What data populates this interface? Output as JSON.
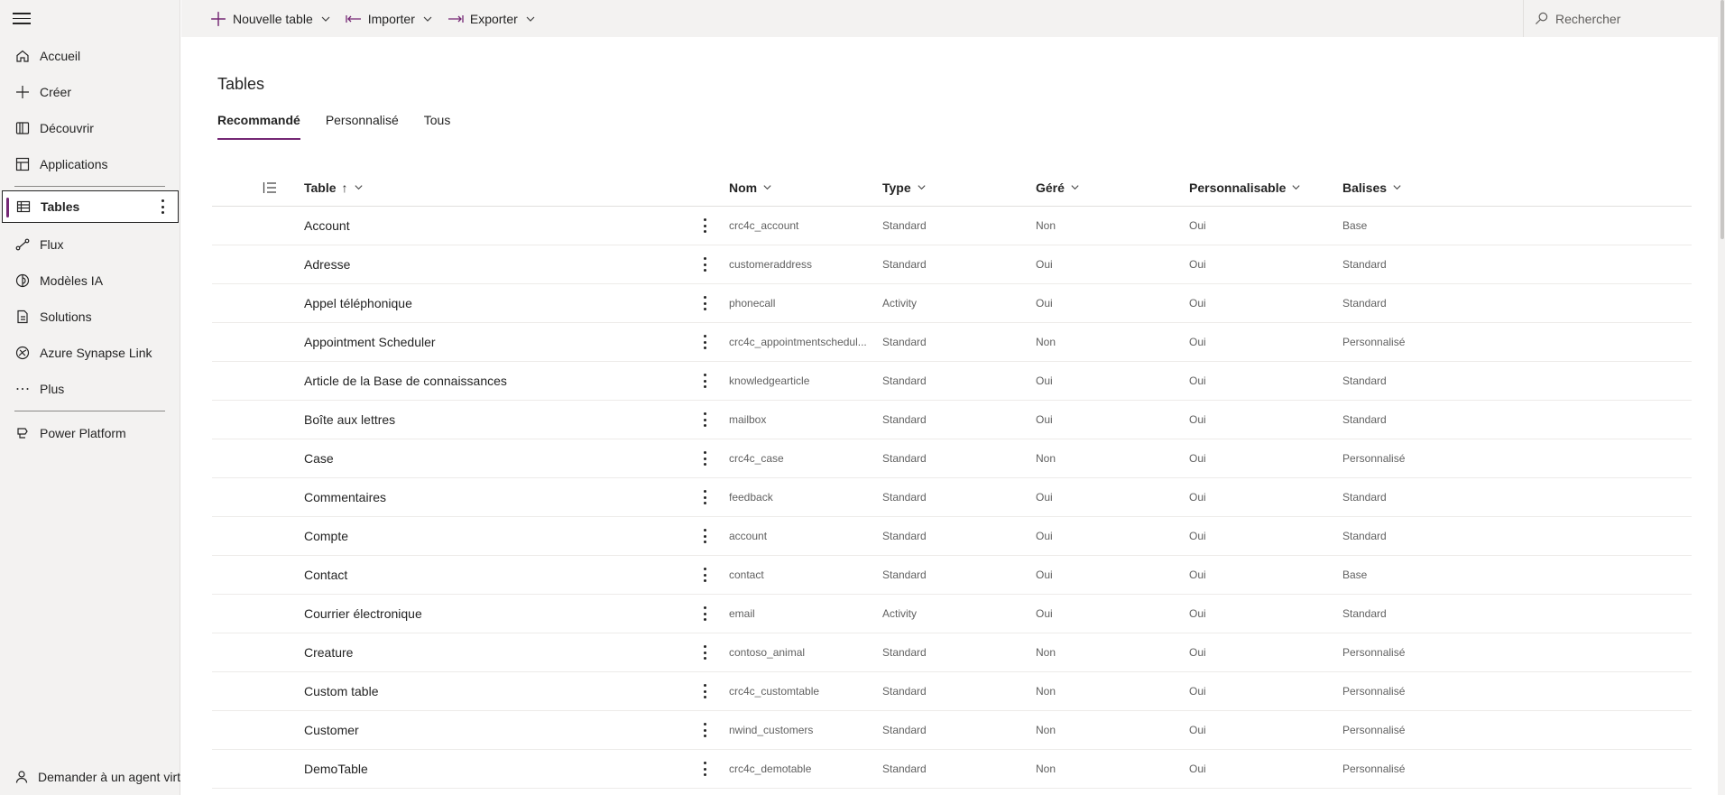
{
  "sidebar": {
    "items": [
      {
        "label": "Accueil",
        "icon": "home-icon"
      },
      {
        "label": "Créer",
        "icon": "plus-icon"
      },
      {
        "label": "Découvrir",
        "icon": "book-icon"
      },
      {
        "label": "Applications",
        "icon": "apps-icon"
      },
      {
        "label": "Tables",
        "icon": "table-icon"
      },
      {
        "label": "Flux",
        "icon": "flow-icon"
      },
      {
        "label": "Modèles IA",
        "icon": "ai-model-icon"
      },
      {
        "label": "Solutions",
        "icon": "solutions-icon"
      },
      {
        "label": "Azure Synapse Link",
        "icon": "synapse-icon"
      },
      {
        "label": "Plus",
        "icon": "ellipsis-icon"
      },
      {
        "label": "Power Platform",
        "icon": "power-platform-icon"
      }
    ],
    "bottom_label": "Demander à un agent virt"
  },
  "toolbar": {
    "new_table": "Nouvelle table",
    "import": "Importer",
    "export": "Exporter",
    "search_placeholder": "Rechercher"
  },
  "page": {
    "title": "Tables",
    "tabs": [
      "Recommandé",
      "Personnalisé",
      "Tous"
    ],
    "active_tab": "Recommandé"
  },
  "grid": {
    "columns": {
      "table": "Table",
      "sort_indicator": "↑",
      "name": "Nom",
      "type": "Type",
      "managed": "Géré",
      "customizable": "Personnalisable",
      "tags": "Balises"
    },
    "rows": [
      {
        "table": "Account",
        "name": "crc4c_account",
        "type": "Standard",
        "managed": "Non",
        "customizable": "Oui",
        "tags": "Base"
      },
      {
        "table": "Adresse",
        "name": "customeraddress",
        "type": "Standard",
        "managed": "Oui",
        "customizable": "Oui",
        "tags": "Standard"
      },
      {
        "table": "Appel téléphonique",
        "name": "phonecall",
        "type": "Activity",
        "managed": "Oui",
        "customizable": "Oui",
        "tags": "Standard"
      },
      {
        "table": "Appointment Scheduler",
        "name": "crc4c_appointmentschedul...",
        "type": "Standard",
        "managed": "Non",
        "customizable": "Oui",
        "tags": "Personnalisé"
      },
      {
        "table": "Article de la Base de connaissances",
        "name": "knowledgearticle",
        "type": "Standard",
        "managed": "Oui",
        "customizable": "Oui",
        "tags": "Standard"
      },
      {
        "table": "Boîte aux lettres",
        "name": "mailbox",
        "type": "Standard",
        "managed": "Oui",
        "customizable": "Oui",
        "tags": "Standard"
      },
      {
        "table": "Case",
        "name": "crc4c_case",
        "type": "Standard",
        "managed": "Non",
        "customizable": "Oui",
        "tags": "Personnalisé"
      },
      {
        "table": "Commentaires",
        "name": "feedback",
        "type": "Standard",
        "managed": "Oui",
        "customizable": "Oui",
        "tags": "Standard"
      },
      {
        "table": "Compte",
        "name": "account",
        "type": "Standard",
        "managed": "Oui",
        "customizable": "Oui",
        "tags": "Standard"
      },
      {
        "table": "Contact",
        "name": "contact",
        "type": "Standard",
        "managed": "Oui",
        "customizable": "Oui",
        "tags": "Base"
      },
      {
        "table": "Courrier électronique",
        "name": "email",
        "type": "Activity",
        "managed": "Oui",
        "customizable": "Oui",
        "tags": "Standard"
      },
      {
        "table": "Creature",
        "name": "contoso_animal",
        "type": "Standard",
        "managed": "Non",
        "customizable": "Oui",
        "tags": "Personnalisé"
      },
      {
        "table": "Custom table",
        "name": "crc4c_customtable",
        "type": "Standard",
        "managed": "Non",
        "customizable": "Oui",
        "tags": "Personnalisé"
      },
      {
        "table": "Customer",
        "name": "nwind_customers",
        "type": "Standard",
        "managed": "Non",
        "customizable": "Oui",
        "tags": "Personnalisé"
      },
      {
        "table": "DemoTable",
        "name": "crc4c_demotable",
        "type": "Standard",
        "managed": "Non",
        "customizable": "Oui",
        "tags": "Personnalisé"
      }
    ]
  },
  "colors": {
    "accent": "#742774",
    "sidebar_bg": "#f3f2f1",
    "text": "#242424",
    "secondary_text": "#616161"
  }
}
